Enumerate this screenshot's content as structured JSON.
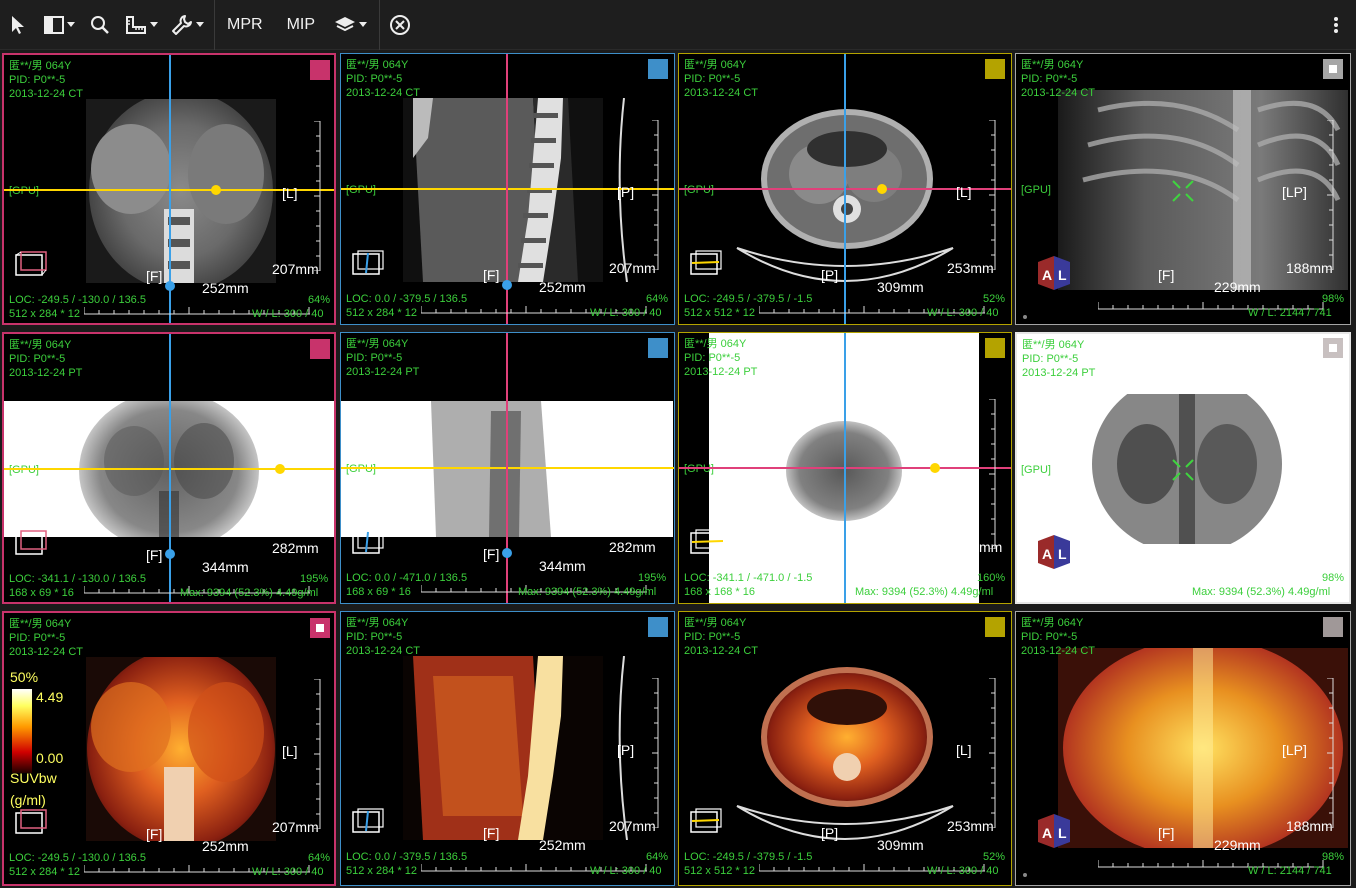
{
  "toolbar": {
    "buttons": [
      {
        "name": "pointer-icon"
      },
      {
        "name": "layout-icon"
      },
      {
        "name": "zoom-icon"
      },
      {
        "name": "ruler-icon"
      },
      {
        "name": "tools-icon"
      }
    ],
    "mpr_label": "MPR",
    "mip_label": "MIP",
    "layers_icon": "layers-icon",
    "close_icon": "close-circle-icon",
    "more_icon": "more-vertical-icon"
  },
  "patient": {
    "name": "匿**/男 064Y",
    "pid": "PID: P0**-5",
    "date_ct": "2013-12-24 CT",
    "date_pt": "2013-12-24 PT"
  },
  "colors": {
    "pink": "#c8336b",
    "blue": "#3e8fc9",
    "yellow": "#b4a300",
    "gray": "#a6a6a6",
    "crosshair_yellow": "#ffd700",
    "crosshair_blue": "#3aa0e8",
    "crosshair_pink": "#e0407a",
    "overlay_green": "#3ccf3c"
  },
  "gpu_label": "[GPU]",
  "viewports": {
    "r1c1": {
      "dir": "[L]",
      "foot": "[F]",
      "width": "207mm",
      "height": "252mm",
      "loc": "LOC: -249.5 / -130.0 / 136.5",
      "dims": "512 x 284 * 12",
      "zoom": "64%",
      "wl": "W / L:   300 / 40"
    },
    "r1c2": {
      "dir": "[P]",
      "foot": "[F]",
      "width": "207mm",
      "height": "252mm",
      "loc": "LOC: 0.0 / -379.5 / 136.5",
      "dims": "512 x 284 * 12",
      "zoom": "64%",
      "wl": "W / L:   300 / 40"
    },
    "r1c3": {
      "dir": "[L]",
      "foot": "[P]",
      "width": "253mm",
      "height": "309mm",
      "loc": "LOC: -249.5 / -379.5 / -1.5",
      "dims": "512 x 512 * 12",
      "zoom": "52%",
      "wl": "W / L:   300 / 40"
    },
    "r1c4": {
      "dir": "[LP]",
      "foot": "[F]",
      "width": "188mm",
      "height": "229mm",
      "zoom": "98%",
      "wl": "W / L:  2144 / 741"
    },
    "r2c1": {
      "foot": "[F]",
      "width": "282mm",
      "height": "344mm",
      "loc": "LOC: -341.1 / -130.0 / 136.5",
      "dims": "168 x 69 * 16",
      "zoom": "195%",
      "max": "Max: 9394 (52.3%) 4.49g/ml"
    },
    "r2c2": {
      "foot": "[F]",
      "width": "282mm",
      "height": "344mm",
      "loc": "LOC: 0.0 / -471.0 / 136.5",
      "dims": "168 x 69 * 16",
      "zoom": "195%",
      "max": "Max: 9394 (52.3%) 4.49g/ml"
    },
    "r2c3": {
      "width": "mm",
      "loc": "LOC: -341.1 / -471.0 / -1.5",
      "dims": "168 x 168 * 16",
      "zoom": "160%",
      "max": "Max: 9394 (52.3%) 4.49g/ml"
    },
    "r2c4": {
      "zoom": "98%",
      "max": "Max: 9394 (52.3%) 4.49g/ml"
    },
    "r3c1": {
      "dir": "[L]",
      "foot": "[F]",
      "width": "207mm",
      "height": "252mm",
      "loc": "LOC: -249.5 / -130.0 / 136.5",
      "dims": "512 x 284 * 12",
      "zoom": "64%",
      "wl": "W / L:   300 / 40",
      "bar_pct": "50%",
      "bar_max": "4.49",
      "bar_min": "0.00",
      "bar_unit1": "SUVbw",
      "bar_unit2": "(g/ml)"
    },
    "r3c2": {
      "dir": "[P]",
      "foot": "[F]",
      "width": "207mm",
      "height": "252mm",
      "loc": "LOC: 0.0 / -379.5 / 136.5",
      "dims": "512 x 284 * 12",
      "zoom": "64%",
      "wl": "W / L:   300 / 40"
    },
    "r3c3": {
      "dir": "[L]",
      "foot": "[P]",
      "width": "253mm",
      "height": "309mm",
      "loc": "LOC: -249.5 / -379.5 / -1.5",
      "dims": "512 x 512 * 12",
      "zoom": "52%",
      "wl": "W / L:   300 / 40"
    },
    "r3c4": {
      "dir": "[LP]",
      "foot": "[F]",
      "width": "188mm",
      "height": "229mm",
      "zoom": "98%",
      "wl": "W / L:  2144 / 741"
    }
  },
  "orientation_letters": {
    "a": "A",
    "l": "L"
  }
}
